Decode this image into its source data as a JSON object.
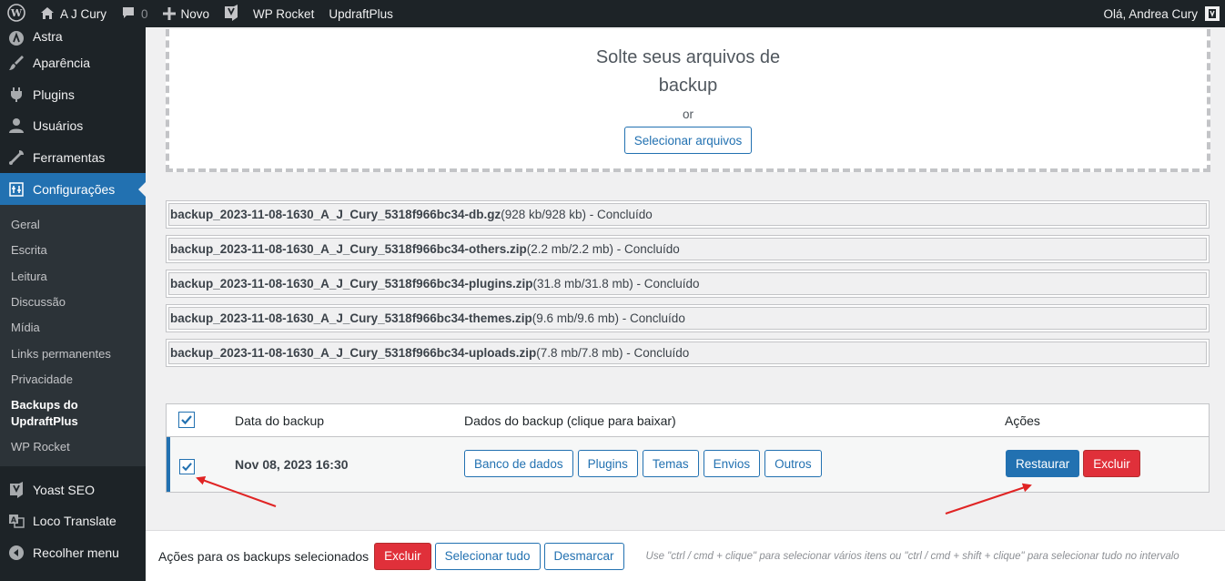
{
  "adminbar": {
    "site_name": "A J Cury",
    "comments_count": "0",
    "new_label": "Novo",
    "wp_rocket": "WP Rocket",
    "updraftplus": "UpdraftPlus",
    "greeting": "Olá, Andrea Cury"
  },
  "sidebar": {
    "items_top": [
      {
        "label": "Astra",
        "icon": "astra-icon"
      },
      {
        "label": "Aparência",
        "icon": "brush-icon"
      },
      {
        "label": "Plugins",
        "icon": "plugin-icon"
      },
      {
        "label": "Usuários",
        "icon": "users-icon"
      },
      {
        "label": "Ferramentas",
        "icon": "wrench-icon"
      }
    ],
    "current": {
      "label": "Configurações",
      "icon": "settings-icon"
    },
    "submenu": [
      "Geral",
      "Escrita",
      "Leitura",
      "Discussão",
      "Mídia",
      "Links permanentes",
      "Privacidade"
    ],
    "submenu_current": "Backups do UpdraftPlus",
    "submenu_after": [
      "WP Rocket"
    ],
    "items_bottom": [
      {
        "label": "Yoast SEO",
        "icon": "yoast-icon"
      },
      {
        "label": "Loco Translate",
        "icon": "translate-icon"
      },
      {
        "label": "Recolher menu",
        "icon": "collapse-icon"
      }
    ]
  },
  "dropzone": {
    "title_line1": "Solte seus arquivos de",
    "title_line2": "backup",
    "or": "or",
    "select_button": "Selecionar arquivos"
  },
  "files": [
    {
      "name": "backup_2023-11-08-1630_A_J_Cury_5318f966bc34-db.gz",
      "detail": " (928 kb/928 kb) - Concluído"
    },
    {
      "name": "backup_2023-11-08-1630_A_J_Cury_5318f966bc34-others.zip",
      "detail": " (2.2 mb/2.2 mb) - Concluído"
    },
    {
      "name": "backup_2023-11-08-1630_A_J_Cury_5318f966bc34-plugins.zip",
      "detail": " (31.8 mb/31.8 mb) - Concluído"
    },
    {
      "name": "backup_2023-11-08-1630_A_J_Cury_5318f966bc34-themes.zip",
      "detail": " (9.6 mb/9.6 mb) - Concluído"
    },
    {
      "name": "backup_2023-11-08-1630_A_J_Cury_5318f966bc34-uploads.zip",
      "detail": " (7.8 mb/7.8 mb) - Concluído"
    }
  ],
  "table": {
    "headers": {
      "date": "Data do backup",
      "data": "Dados do backup (clique para baixar)",
      "actions": "Ações"
    },
    "row": {
      "date": "Nov 08, 2023 16:30",
      "data_buttons": [
        "Banco de dados",
        "Plugins",
        "Temas",
        "Envios",
        "Outros"
      ],
      "restore": "Restaurar",
      "delete": "Excluir"
    }
  },
  "bottombar": {
    "label": "Ações para os backups selecionados",
    "delete": "Excluir",
    "select_all": "Selecionar tudo",
    "deselect": "Desmarcar",
    "hint": "Use \"ctrl / cmd + clique\" para selecionar vários itens ou \"ctrl / cmd + shift + clique\" para selecionar tudo no intervalo"
  },
  "colors": {
    "accent": "#2271b1",
    "danger": "#e0303a",
    "arrow": "#e02424"
  }
}
